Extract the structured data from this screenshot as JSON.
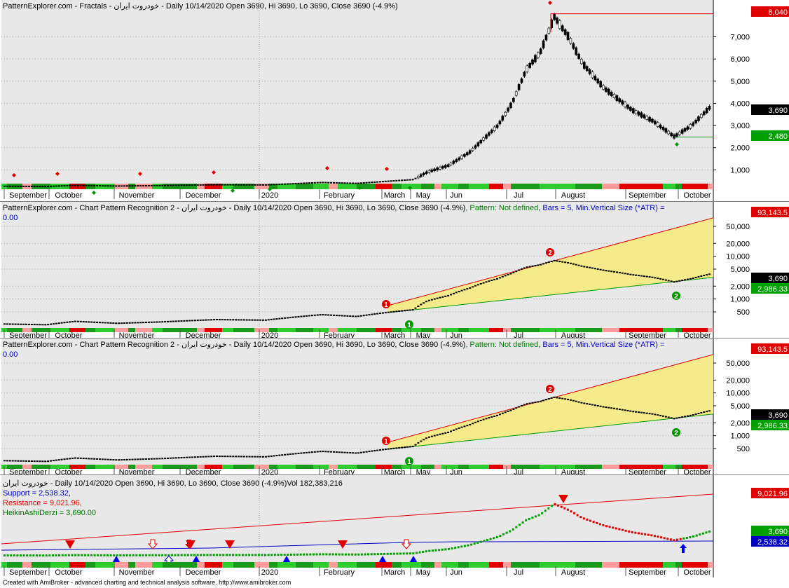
{
  "footer": "Created with AmiBroker - advanced charting and technical analysis software. http://www.amibroker.com",
  "colors": {
    "bg": "#e8e8e8",
    "red": "#e00000",
    "green": "#00a000",
    "blue": "#0000c0",
    "yellow": "#f5eb8a"
  },
  "x_axis_labels": [
    "September",
    "October",
    "November",
    "December",
    "2020",
    "February",
    "March",
    "May",
    "Jun",
    "Jul",
    "August",
    "September",
    "October"
  ],
  "panes": [
    {
      "header": "PatternExplorer.com - Fractals - خودروت ایران - Daily 10/14/2020 Open 3690, Hi 3690, Lo 3690, Close 3690 (-4.9%)",
      "y_ticks": [
        "7,000",
        "6,000",
        "5,000",
        "4,000",
        "3,000",
        "2,000",
        "1,000"
      ],
      "badges": [
        {
          "text": "8,040",
          "kind": "red"
        },
        {
          "text": "3,690",
          "kind": "black"
        },
        {
          "text": "2,480",
          "kind": "green"
        }
      ]
    },
    {
      "header_main": "PatternExplorer.com - Chart Pattern Recognition 2 - خودروت ایران - Daily 10/14/2020 Open 3690, Hi 3690, Lo 3690, Close 3690 (-4.9%)",
      "header_pattern": ", Pattern: Not defined",
      "header_params": ", Bars = 5, Min.Vertical Size (*ATR) =",
      "header_value": "0.00",
      "y_ticks": [
        "50,000",
        "20,000",
        "10,000",
        "5,000",
        "2,000",
        "1,000",
        "500"
      ],
      "badges": [
        {
          "text": "93,143.5",
          "kind": "red"
        },
        {
          "text": "3,690",
          "kind": "black"
        },
        {
          "text": "2,986.33",
          "kind": "green"
        }
      ],
      "markers": [
        "1",
        "2",
        "1",
        "2"
      ]
    },
    {
      "header_main": "PatternExplorer.com - Chart Pattern Recognition 2 - خودروت ایران - Daily 10/14/2020 Open 3690, Hi 3690, Lo 3690, Close 3690 (-4.9%)",
      "header_pattern": ", Pattern: Not defined",
      "header_params": ", Bars = 5, Min.Vertical Size (*ATR) =",
      "header_value": "0.00",
      "y_ticks": [
        "50,000",
        "20,000",
        "10,000",
        "5,000",
        "2,000",
        "1,000",
        "500"
      ],
      "badges": [
        {
          "text": "93,143.5",
          "kind": "red"
        },
        {
          "text": "3,690",
          "kind": "black"
        },
        {
          "text": "2,986.33",
          "kind": "green"
        }
      ],
      "markers": [
        "1",
        "2",
        "1",
        "2"
      ]
    },
    {
      "header": "خودروت ایران - Daily 10/14/2020 Open 3690, Hi 3690, Lo 3690, Close 3690 (-4.9%)Vol 182,383,216",
      "support": "Support = 2,538.32,",
      "resistance": "Resistance = 9,021.96,",
      "heikin": "HeikinAshiDerzi = 3,690.00",
      "badges": [
        {
          "text": "9,021.96",
          "kind": "red"
        },
        {
          "text": "3,690",
          "kind": "green"
        },
        {
          "text": "2,538.32",
          "kind": "blue"
        }
      ]
    }
  ],
  "chart_data": [
    {
      "type": "candlestick",
      "title": "PatternExplorer.com - Fractals",
      "x_range": [
        "2019-09",
        "2020-10"
      ],
      "ylim": [
        0,
        8500
      ],
      "close_series_approx": [
        {
          "x": "2019-09",
          "y": 260
        },
        {
          "x": "2019-10",
          "y": 300
        },
        {
          "x": "2019-11",
          "y": 280
        },
        {
          "x": "2019-12",
          "y": 320
        },
        {
          "x": "2020-01",
          "y": 340
        },
        {
          "x": "2020-02",
          "y": 430
        },
        {
          "x": "2020-03",
          "y": 520
        },
        {
          "x": "2020-04",
          "y": 900
        },
        {
          "x": "2020-05",
          "y": 1400
        },
        {
          "x": "2020-06",
          "y": 2600
        },
        {
          "x": "2020-07",
          "y": 5800
        },
        {
          "x": "2020-07-25",
          "y": 7800
        },
        {
          "x": "2020-08",
          "y": 6200
        },
        {
          "x": "2020-08-20",
          "y": 4600
        },
        {
          "x": "2020-09",
          "y": 3600
        },
        {
          "x": "2020-09-25",
          "y": 2500
        },
        {
          "x": "2020-10-14",
          "y": 3690
        }
      ],
      "levels": {
        "high": 8040,
        "last": 3690,
        "low": 2480
      }
    },
    {
      "type": "line",
      "title": "PatternExplorer.com - Chart Pattern Recognition 2",
      "scale": "log",
      "ylim": [
        300,
        93143.5
      ],
      "lines": [
        {
          "name": "Resistance",
          "from": 700,
          "to": 93143.5
        },
        {
          "name": "Support",
          "from": 500,
          "to": 2986.33
        }
      ]
    },
    {
      "type": "line",
      "title": "Support / Resistance / HeikinAshiDerzi",
      "series": [
        {
          "name": "Support",
          "last": 2538.32
        },
        {
          "name": "Resistance",
          "last": 9021.96
        },
        {
          "name": "HeikinAshiDerzi",
          "last": 3690.0
        }
      ]
    }
  ]
}
